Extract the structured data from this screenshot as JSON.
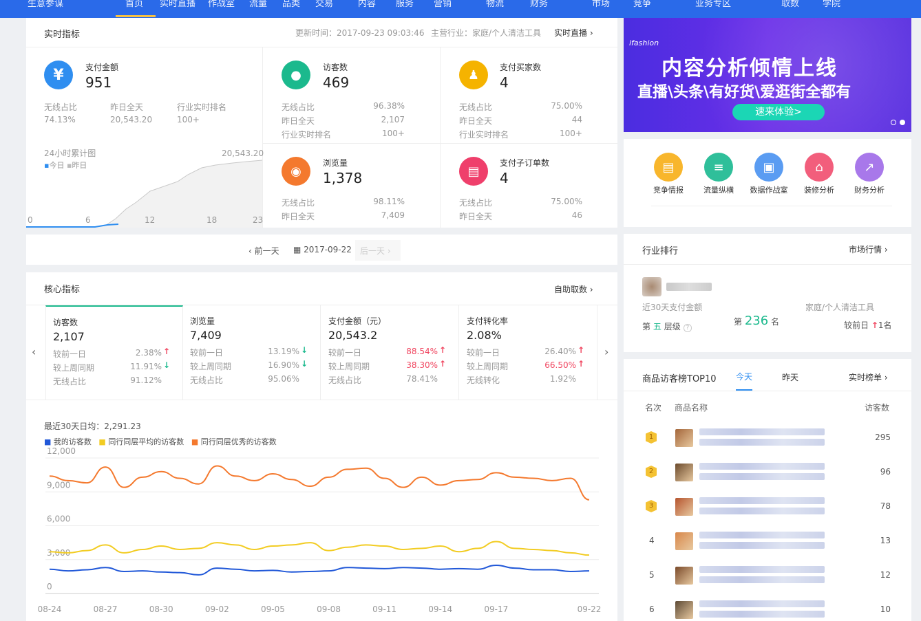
{
  "topbar": {
    "items": [
      "生意参谋",
      "首页",
      "实时直播",
      "作战室",
      "流量",
      "品类",
      "交易",
      "内容",
      "服务",
      "营销",
      "物流",
      "财务",
      "市场",
      "竞争",
      "业务专区",
      "取数",
      "学院"
    ]
  },
  "realtime": {
    "title": "实时指标",
    "update_time": "更新时间：2017-09-23 09:03:46",
    "industry": "主营行业：家庭/个人清洁工具",
    "live_link": "实时直播",
    "pay": {
      "label": "支付金额",
      "value": "951",
      "stats": [
        {
          "label": "无线占比",
          "value": "74.13%"
        },
        {
          "label": "昨日全天",
          "value": "20,543.20"
        },
        {
          "label": "行业实时排名",
          "value": "100+"
        }
      ]
    },
    "chart": {
      "title": "24小时累计图",
      "legend": [
        "今日",
        "昨日"
      ],
      "max_label": "20,543.20",
      "x_ticks": [
        "0",
        "6",
        "12",
        "18",
        "23"
      ]
    },
    "metrics": [
      {
        "label": "访客数",
        "value": "469",
        "stats": [
          {
            "label": "无线占比",
            "value": "96.38%"
          },
          {
            "label": "昨日全天",
            "value": "2,107"
          },
          {
            "label": "行业实时排名",
            "value": "100+"
          }
        ],
        "color": "#1bb98d"
      },
      {
        "label": "支付买家数",
        "value": "4",
        "stats": [
          {
            "label": "无线占比",
            "value": "75.00%"
          },
          {
            "label": "昨日全天",
            "value": "44"
          },
          {
            "label": "行业实时排名",
            "value": "100+"
          }
        ],
        "color": "#f5b300"
      },
      {
        "label": "浏览量",
        "value": "1,378",
        "stats": [
          {
            "label": "无线占比",
            "value": "98.11%"
          },
          {
            "label": "昨日全天",
            "value": "7,409"
          }
        ],
        "color": "#f4792e"
      },
      {
        "label": "支付子订单数",
        "value": "4",
        "stats": [
          {
            "label": "无线占比",
            "value": "75.00%"
          },
          {
            "label": "昨日全天",
            "value": "46"
          }
        ],
        "color": "#ef3f6b"
      }
    ]
  },
  "date_nav": {
    "prev": "前一天",
    "date": "2017-09-22",
    "next": "后一天"
  },
  "core": {
    "title": "核心指标",
    "link": "自助取数",
    "tabs": [
      {
        "label": "访客数",
        "value": "2,107",
        "rows": [
          {
            "label": "较前一日",
            "value": "2.38%",
            "trend": "up"
          },
          {
            "label": "较上周同期",
            "value": "11.91%",
            "trend": "down"
          },
          {
            "label": "无线占比",
            "value": "91.12%",
            "trend": ""
          }
        ]
      },
      {
        "label": "浏览量",
        "value": "7,409",
        "rows": [
          {
            "label": "较前一日",
            "value": "13.19%",
            "trend": "down"
          },
          {
            "label": "较上周同期",
            "value": "16.90%",
            "trend": "down"
          },
          {
            "label": "无线占比",
            "value": "95.06%",
            "trend": ""
          }
        ]
      },
      {
        "label": "支付金额（元）",
        "value": "20,543.2",
        "rows": [
          {
            "label": "较前一日",
            "value": "88.54%",
            "trend": "up"
          },
          {
            "label": "较上周同期",
            "value": "38.30%",
            "trend": "up"
          },
          {
            "label": "无线占比",
            "value": "78.41%",
            "trend": ""
          }
        ]
      },
      {
        "label": "支付转化率",
        "value": "2.08%",
        "rows": [
          {
            "label": "较前一日",
            "value": "26.40%",
            "trend": "up"
          },
          {
            "label": "较上周同期",
            "value": "66.50%",
            "trend": "up"
          },
          {
            "label": "无线转化",
            "value": "1.92%",
            "trend": ""
          }
        ]
      }
    ],
    "avg_label": "最近30天日均：2,291.23"
  },
  "chart_data": {
    "type": "line",
    "x": [
      "08-24",
      "08-25",
      "08-26",
      "08-27",
      "08-28",
      "08-29",
      "08-30",
      "08-31",
      "09-01",
      "09-02",
      "09-03",
      "09-04",
      "09-05",
      "09-06",
      "09-07",
      "09-08",
      "09-09",
      "09-10",
      "09-11",
      "09-12",
      "09-13",
      "09-14",
      "09-15",
      "09-16",
      "09-17",
      "09-18",
      "09-19",
      "09-20",
      "09-21",
      "09-22"
    ],
    "x_ticks": [
      "08-24",
      "08-27",
      "08-30",
      "09-02",
      "09-05",
      "09-08",
      "09-11",
      "09-14",
      "09-17",
      "09-22"
    ],
    "ylim": [
      0,
      12000
    ],
    "y_ticks": [
      "0",
      "3,000",
      "6,000",
      "9,000",
      "12,000"
    ],
    "grid": true,
    "legend_position": "top-left",
    "series": [
      {
        "name": "我的访客数",
        "color": "#2158d8",
        "values": [
          2150,
          2000,
          2100,
          2300,
          1950,
          2000,
          1900,
          1850,
          1650,
          2250,
          2150,
          2000,
          2050,
          1900,
          1950,
          2000,
          2300,
          2250,
          2200,
          2300,
          2250,
          2150,
          2200,
          2150,
          2500,
          2250,
          2100,
          2100,
          1950,
          2000
        ]
      },
      {
        "name": "同行同层平均的访客数",
        "color": "#f2cc22",
        "values": [
          3700,
          3600,
          3800,
          4300,
          3600,
          3900,
          4200,
          3900,
          4000,
          4500,
          4300,
          3900,
          4200,
          4300,
          4500,
          3800,
          4100,
          4300,
          4200,
          3900,
          4000,
          4200,
          3700,
          4000,
          4600,
          4000,
          3900,
          3800,
          3600,
          3400
        ]
      },
      {
        "name": "同行同层优秀的访客数",
        "color": "#f4792e",
        "values": [
          10400,
          10000,
          9800,
          11200,
          9400,
          10300,
          10800,
          10200,
          9700,
          11300,
          10400,
          10000,
          10600,
          10100,
          9500,
          10300,
          11000,
          11100,
          10200,
          9400,
          10300,
          9600,
          10000,
          10100,
          10700,
          10300,
          10200,
          10000,
          10200,
          8300
        ]
      }
    ]
  },
  "banner": {
    "headline": "内容分析倾情上线",
    "subline": "直播\\头条\\有好货\\爱逛街全都有",
    "button": "速来体验>",
    "brand": "ifashion"
  },
  "tools": [
    {
      "label": "竞争情报",
      "color": "#f8b62c"
    },
    {
      "label": "流量纵横",
      "color": "#2fbf9a"
    },
    {
      "label": "数据作战室",
      "color": "#5a9cf2"
    },
    {
      "label": "装修分析",
      "color": "#f25e7c"
    },
    {
      "label": "财务分析",
      "color": "#a878ea"
    }
  ],
  "industry_rank": {
    "title": "行业排行",
    "link": "市场行情",
    "pay_label": "近30天支付金额",
    "category": "家庭/个人清洁工具",
    "tier_prefix": "第",
    "tier": "五",
    "tier_suffix": "层级",
    "rank_prefix": "第",
    "rank": "236",
    "rank_suffix": "名",
    "compare": "较前日",
    "change": "1名"
  },
  "top10": {
    "title": "商品访客榜TOP10",
    "tabs": [
      "今天",
      "昨天"
    ],
    "link": "实时榜单",
    "headers": [
      "名次",
      "商品名称",
      "访客数"
    ],
    "rows": [
      {
        "rank": "1",
        "visitors": "295"
      },
      {
        "rank": "2",
        "visitors": "96"
      },
      {
        "rank": "3",
        "visitors": "78"
      },
      {
        "rank": "4",
        "visitors": "13"
      },
      {
        "rank": "5",
        "visitors": "12"
      },
      {
        "rank": "6",
        "visitors": "10"
      }
    ]
  }
}
